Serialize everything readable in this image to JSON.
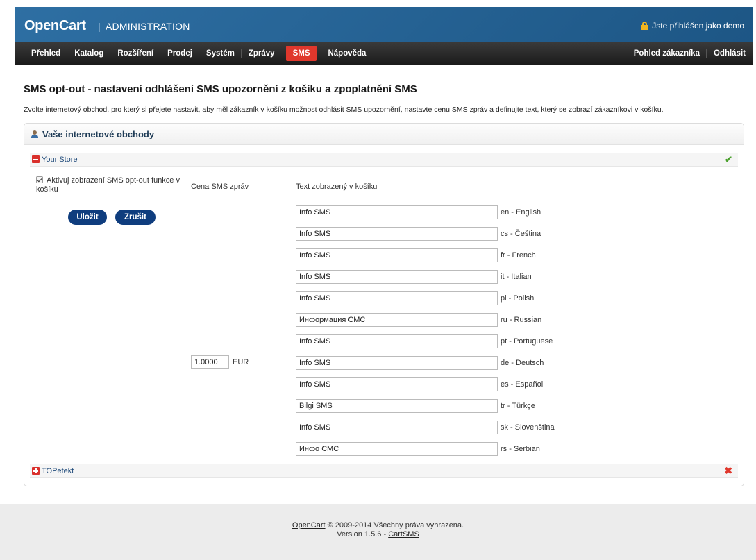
{
  "header": {
    "logo": "OpenCart",
    "separator": "|",
    "subtitle": "ADMINISTRATION",
    "login_text": "Jste přihlášen jako demo"
  },
  "menu": {
    "left": [
      "Přehled",
      "Katalog",
      "Rozšíření",
      "Prodej",
      "Systém",
      "Zprávy",
      "SMS",
      "Nápověda"
    ],
    "active": "SMS",
    "right": [
      "Pohled zákazníka",
      "Odhlásit"
    ]
  },
  "page": {
    "title": "SMS opt-out - nastavení odhlášení SMS upozornění z košíku a zpoplatnění SMS",
    "intro": "Zvolte internetový obchod, pro který si přejete nastavit, aby měl zákazník v košíku možnost odhlásit SMS upozornění, nastavte cenu SMS zpráv a definujte text, který se zobrazí zákazníkovi v košíku."
  },
  "panel": {
    "title": "Vaše internetové obchody",
    "store1": "Your Store",
    "store2": "TOPefekt",
    "activate_label": "Aktivuj zobrazení SMS opt-out funkce v košíku",
    "activate_checked": true,
    "save_label": "Uložit",
    "cancel_label": "Zrušit",
    "price_header": "Cena SMS zpráv",
    "text_header": "Text zobrazený v košíku",
    "price_value": "1.0000",
    "currency": "EUR",
    "languages": [
      {
        "value": "Info SMS",
        "label": "en - English"
      },
      {
        "value": "Info SMS",
        "label": "cs - Čeština"
      },
      {
        "value": "Info SMS",
        "label": "fr - French"
      },
      {
        "value": "Info SMS",
        "label": "it - Italian"
      },
      {
        "value": "Info SMS",
        "label": "pl - Polish"
      },
      {
        "value": "Информация СМС",
        "label": "ru - Russian"
      },
      {
        "value": "Info SMS",
        "label": "pt - Portuguese"
      },
      {
        "value": "Info SMS",
        "label": "de - Deutsch"
      },
      {
        "value": "Info SMS",
        "label": "es - Español"
      },
      {
        "value": "Bilgi SMS",
        "label": "tr - Türkçe"
      },
      {
        "value": "Info SMS",
        "label": "sk - Slovenština"
      },
      {
        "value": "Инфо СМС",
        "label": "rs - Serbian"
      }
    ]
  },
  "footer": {
    "link1": "OpenCart",
    "line1_rest": " © 2009-2014 Všechny práva vyhrazena.",
    "line2_prefix": "Version 1.5.6 - ",
    "link2": "CartSMS"
  },
  "colors": {
    "header_blue": "#1d5685",
    "menu_dark": "#1b1b1b",
    "active_red": "#e0372c",
    "button_navy": "#0f3d7e",
    "check_green": "#4aa02c"
  }
}
